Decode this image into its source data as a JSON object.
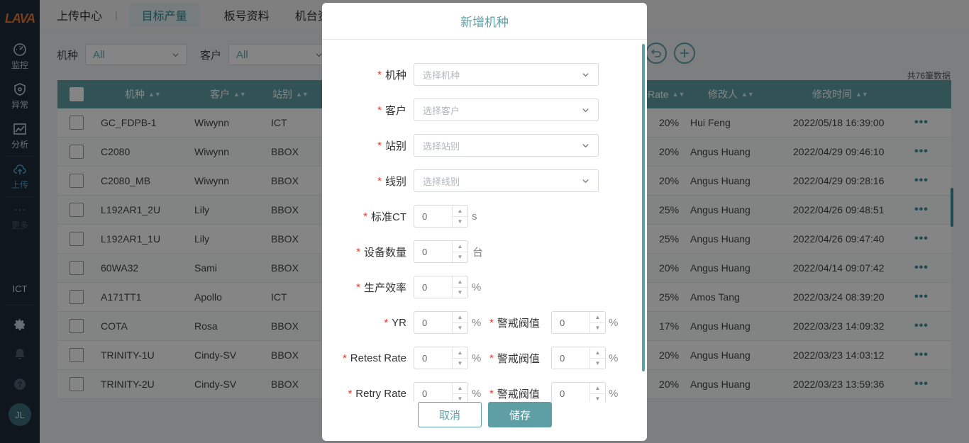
{
  "app": {
    "logo": "LAVA"
  },
  "sidebar": {
    "items": [
      {
        "label": "监控",
        "icon": "gauge-icon"
      },
      {
        "label": "异常",
        "icon": "shield-icon"
      },
      {
        "label": "分析",
        "icon": "chart-icon"
      },
      {
        "label": "上传",
        "icon": "cloud-upload-icon"
      },
      {
        "label": "更多",
        "icon": "more-dots-icon"
      }
    ],
    "station": "ICT",
    "user_initials": "JL"
  },
  "topbar": {
    "tabs": [
      "上传中心",
      "目标产量",
      "板号资料",
      "机台资料"
    ],
    "active_tab": "目标产量"
  },
  "filters": {
    "model_label": "机种",
    "model_value": "All",
    "customer_label": "客户",
    "customer_value": "All"
  },
  "record_count": "共76筆数据",
  "table": {
    "headers": {
      "model": "机种",
      "customer": "客户",
      "station": "站别",
      "rate": "Rate",
      "modifier": "修改人",
      "modified_time": "修改时间"
    },
    "rows": [
      {
        "model": "GC_FDPB-1",
        "customer": "Wiwynn",
        "station": "ICT",
        "rate": "20%",
        "modifier": "Hui Feng",
        "time": "2022/05/18 16:39:00"
      },
      {
        "model": "C2080",
        "customer": "Wiwynn",
        "station": "BBOX",
        "rate": "20%",
        "modifier": "Angus Huang",
        "time": "2022/04/29 09:46:10"
      },
      {
        "model": "C2080_MB",
        "customer": "Wiwynn",
        "station": "BBOX",
        "rate": "20%",
        "modifier": "Angus Huang",
        "time": "2022/04/29 09:28:16"
      },
      {
        "model": "L192AR1_2U",
        "customer": "Lily",
        "station": "BBOX",
        "rate": "25%",
        "modifier": "Angus Huang",
        "time": "2022/04/26 09:48:51"
      },
      {
        "model": "L192AR1_1U",
        "customer": "Lily",
        "station": "BBOX",
        "rate": "25%",
        "modifier": "Angus Huang",
        "time": "2022/04/26 09:47:40"
      },
      {
        "model": "60WA32",
        "customer": "Sami",
        "station": "BBOX",
        "rate": "20%",
        "modifier": "Angus Huang",
        "time": "2022/04/14 09:07:42"
      },
      {
        "model": "A171TT1",
        "customer": "Apollo",
        "station": "ICT",
        "rate": "25%",
        "modifier": "Amos Tang",
        "time": "2022/03/24 08:39:20"
      },
      {
        "model": "COTA",
        "customer": "Rosa",
        "station": "BBOX",
        "rate": "17%",
        "modifier": "Angus Huang",
        "time": "2022/03/23 14:09:32"
      },
      {
        "model": "TRINITY-1U",
        "customer": "Cindy-SV",
        "station": "BBOX",
        "rate": "20%",
        "modifier": "Angus Huang",
        "time": "2022/03/23 14:03:12"
      },
      {
        "model": "TRINITY-2U",
        "customer": "Cindy-SV",
        "station": "BBOX",
        "rate": "20%",
        "modifier": "Angus Huang",
        "time": "2022/03/23 13:59:36"
      }
    ]
  },
  "modal": {
    "title": "新增机种",
    "model_label": "机种",
    "model_placeholder": "选择机种",
    "customer_label": "客户",
    "customer_placeholder": "选择客户",
    "station_label": "站别",
    "station_placeholder": "选择站别",
    "line_label": "线别",
    "line_placeholder": "选择线别",
    "ct_label": "标准CT",
    "ct_value": "0",
    "ct_unit": "s",
    "qty_label": "设备数量",
    "qty_value": "0",
    "qty_unit": "台",
    "eff_label": "生产效率",
    "eff_value": "0",
    "eff_unit": "%",
    "yr_label": "YR",
    "yr_value": "0",
    "yr_unit": "%",
    "yr_warn_label": "警戒阀值",
    "yr_warn_value": "0",
    "yr_warn_unit": "%",
    "retest_label": "Retest Rate",
    "retest_value": "0",
    "retest_unit": "%",
    "retest_warn_label": "警戒阀值",
    "retest_warn_value": "0",
    "retest_warn_unit": "%",
    "retry_label": "Retry Rate",
    "retry_value": "0",
    "retry_unit": "%",
    "retry_warn_label": "警戒阀值",
    "retry_warn_value": "0",
    "retry_warn_unit": "%",
    "required_mark": "*",
    "cancel_label": "取消",
    "save_label": "储存"
  },
  "colors": {
    "accent": "#5e9fa6",
    "sidebar": "#1d2b3a",
    "required": "#e03a2f"
  }
}
